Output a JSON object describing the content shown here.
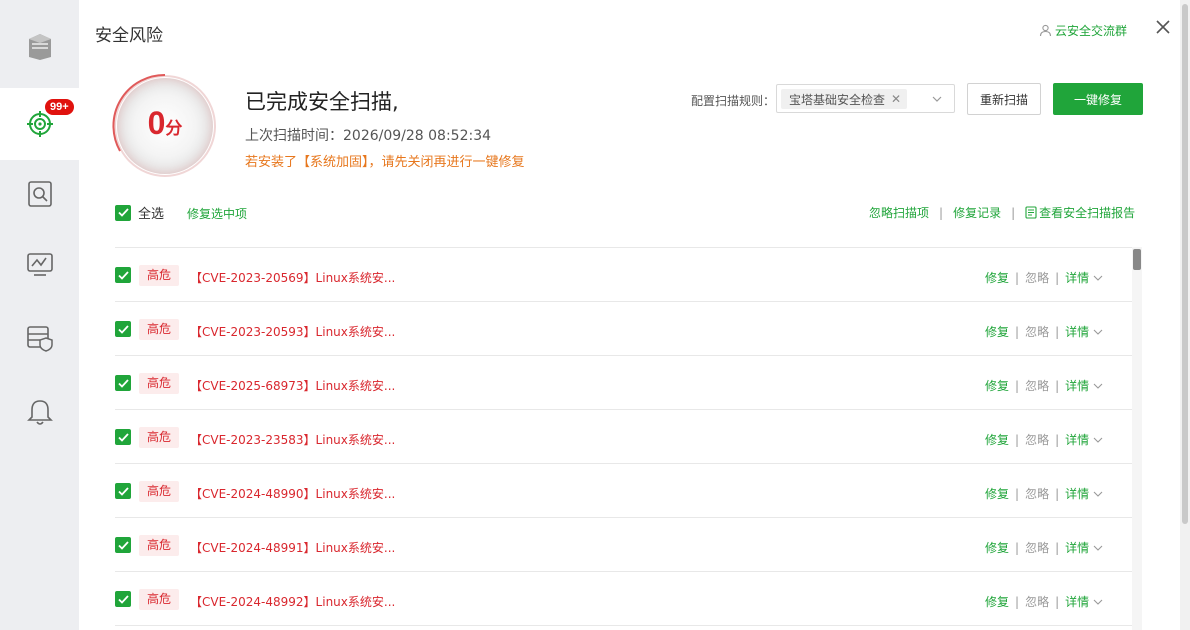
{
  "sidebar": {
    "badge": "99+",
    "items": [
      {
        "icon": "server-icon"
      },
      {
        "icon": "target-scan-icon",
        "active": true
      },
      {
        "icon": "file-search-icon"
      },
      {
        "icon": "monitor-chart-icon"
      },
      {
        "icon": "server-shield-icon"
      },
      {
        "icon": "bell-icon"
      }
    ]
  },
  "header": {
    "title": "安全风险",
    "community_link": "云安全交流群"
  },
  "score": {
    "value": "0",
    "unit": "分"
  },
  "scan": {
    "title": "已完成安全扫描,",
    "last_time": "上次扫描时间：2026/09/28 08:52:34",
    "warning": "若安装了【系统加固】，请先关闭再进行一键修复"
  },
  "toolbar": {
    "rule_label": "配置扫描规则：",
    "rule_tag": "宝塔基础安全检查",
    "rescan_label": "重新扫描",
    "fix_all_label": "一键修复"
  },
  "list_controls": {
    "select_all_label": "全选",
    "fix_selected_label": "修复选中项",
    "ignore_items_label": "忽略扫描项",
    "fix_history_label": "修复记录",
    "report_label": "查看安全扫描报告"
  },
  "row_actions": {
    "fix": "修复",
    "ignore": "忽略",
    "detail": "详情"
  },
  "risks": [
    {
      "level": "高危",
      "title": "【CVE-2023-20569】Linux系统安..."
    },
    {
      "level": "高危",
      "title": "【CVE-2023-20593】Linux系统安..."
    },
    {
      "level": "高危",
      "title": "【CVE-2025-68973】Linux系统安..."
    },
    {
      "level": "高危",
      "title": "【CVE-2023-23583】Linux系统安..."
    },
    {
      "level": "高危",
      "title": "【CVE-2024-48990】Linux系统安..."
    },
    {
      "level": "高危",
      "title": "【CVE-2024-48991】Linux系统安..."
    },
    {
      "level": "高危",
      "title": "【CVE-2024-48992】Linux系统安..."
    }
  ],
  "colors": {
    "accent": "#20a53a",
    "danger": "#d9272e",
    "warning": "#e7771d",
    "badge": "#e0120e"
  }
}
